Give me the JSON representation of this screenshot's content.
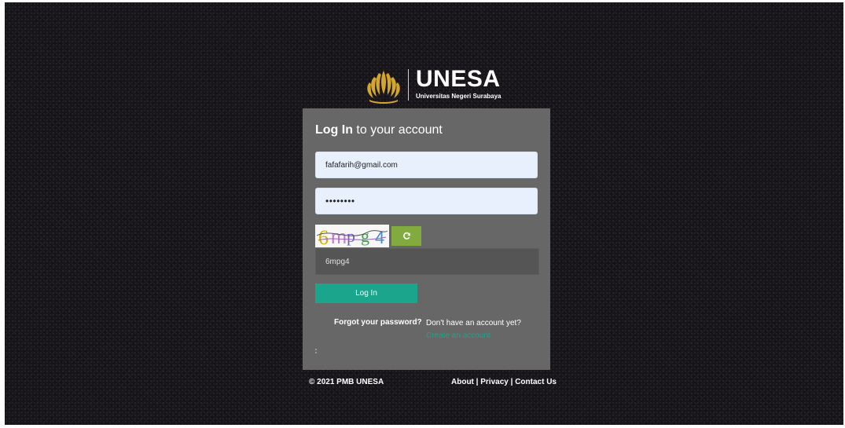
{
  "brand": {
    "name": "UNESA",
    "subtitle": "Universitas Negeri Surabaya",
    "color": "#d4a62a"
  },
  "login": {
    "title_bold": "Log In",
    "title_rest": " to your account",
    "email_value": "fafafarih@gmail.com",
    "password_value": "11111111",
    "captcha_text": "6mpg4",
    "captcha_input_value": "6mpg4",
    "refresh_icon": "refresh-icon",
    "button_label": "Log In",
    "forgot_label": "Forgot your password?",
    "no_account_label": "Don't have an account yet?",
    "create_label": "Create an account"
  },
  "footer": {
    "copyright": "© 2021 PMB UNESA",
    "links": [
      "About",
      "Privacy",
      "Contact Us"
    ],
    "separator": " | "
  },
  "colors": {
    "panel": "#676767",
    "accent": "#1aa58c",
    "refresh": "#82ab3f",
    "input_fill": "#e8f0fd"
  }
}
